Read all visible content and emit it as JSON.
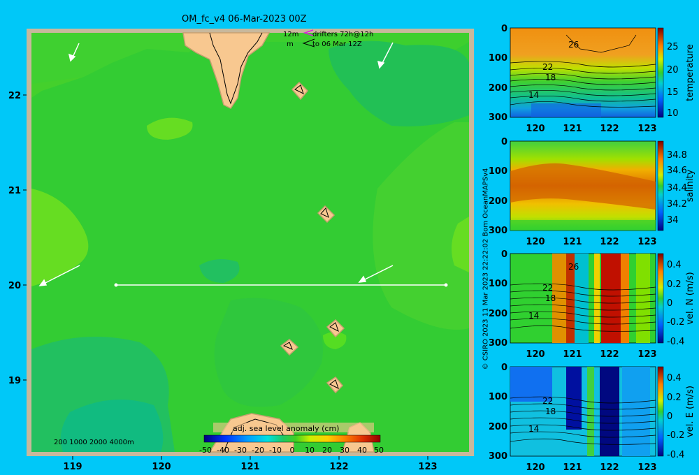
{
  "title": "OM_fc_v4  06-Mar-2023 00Z",
  "legend": {
    "drifters_label": "12m",
    "drifters_text": "drifters 72h@12h",
    "vectors_label": "m",
    "vectors_text": "to 06 Mar 12Z"
  },
  "map": {
    "x_ticks": [
      "119",
      "120",
      "121",
      "122",
      "123"
    ],
    "y_ticks": [
      "22",
      "21",
      "20",
      "19"
    ],
    "depth_legend": "200  1000  2000  4000m",
    "colorbar_title": "adj. sea level anomaly (cm)",
    "colorbar_ticks": [
      "-50",
      "-40",
      "-30",
      "-20",
      "-10",
      "0",
      "10",
      "20",
      "30",
      "40",
      "50"
    ],
    "colors": {
      "sea_main": "#33cc33",
      "sea_light": "#55dd22",
      "sea_teal": "#11bb66",
      "land": "#f8c890",
      "frame": "#c8b89c"
    }
  },
  "sections": [
    {
      "id": "temperature",
      "label": "temperature",
      "y_ticks": [
        "0",
        "100",
        "200",
        "300"
      ],
      "x_ticks": [
        "120",
        "121",
        "122",
        "123"
      ],
      "cb_ticks": [
        "25",
        "20",
        "15",
        "10"
      ],
      "contour_labels": [
        "26",
        "22",
        "18",
        "14"
      ]
    },
    {
      "id": "salinity",
      "label": "salinity",
      "y_ticks": [
        "0",
        "100",
        "200",
        "300"
      ],
      "x_ticks": [
        "120",
        "121",
        "122",
        "123"
      ],
      "cb_ticks": [
        "34.8",
        "34.6",
        "34.4",
        "34.2",
        "34"
      ],
      "contour_labels": []
    },
    {
      "id": "vel-n",
      "label": "vel. N (m/s)",
      "y_ticks": [
        "0",
        "100",
        "200",
        "300"
      ],
      "x_ticks": [
        "120",
        "121",
        "122",
        "123"
      ],
      "cb_ticks": [
        "0.4",
        "0.2",
        "0",
        "-0.2",
        "-0.4"
      ],
      "contour_labels": [
        "26",
        "22",
        "18",
        "14"
      ]
    },
    {
      "id": "vel-e",
      "label": "vel. E (m/s)",
      "y_ticks": [
        "0",
        "100",
        "200",
        "300"
      ],
      "x_ticks": [
        "120",
        "121",
        "122",
        "123"
      ],
      "cb_ticks": [
        "0.4",
        "0.2",
        "0",
        "-0.2",
        "-0.4"
      ],
      "contour_labels": [
        "22",
        "18",
        "14"
      ]
    }
  ],
  "copyright": "© CSIRO 2023   11 Mar 2023 22:22:02 Bom OceanMAPSv4"
}
